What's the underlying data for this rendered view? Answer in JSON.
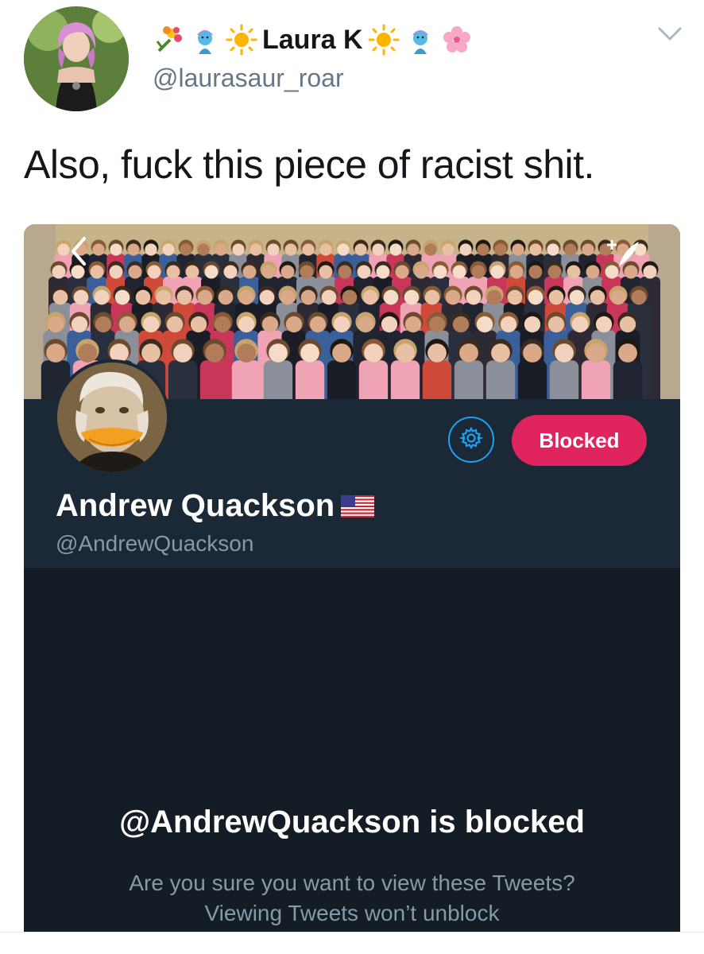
{
  "tweet": {
    "display_name": "Laura K",
    "name_emojis_left": [
      "bouquet-icon",
      "genie-icon",
      "sun-icon"
    ],
    "name_emojis_right": [
      "sun-icon",
      "genie-icon",
      "blossom-icon"
    ],
    "handle": "@laurasaur_roar",
    "text": "Also, fuck this piece of racist shit."
  },
  "profile_card": {
    "display_name": "Andrew Quackson",
    "name_badge": "us-flag-icon",
    "handle": "@AndrewQuackson",
    "blocked_button_label": "Blocked",
    "blocked_title": "@AndrewQuackson is blocked",
    "blocked_body_line1": "Are you sure you want to view these Tweets?",
    "blocked_body_line2": "Viewing Tweets won’t unblock"
  },
  "colors": {
    "card_bg": "#141d26",
    "strip_bg": "#1b2836",
    "blocked_red": "#e0245e",
    "twitter_blue": "#1da1f2",
    "muted_text": "#8899a6",
    "handle_gray": "#657786"
  }
}
